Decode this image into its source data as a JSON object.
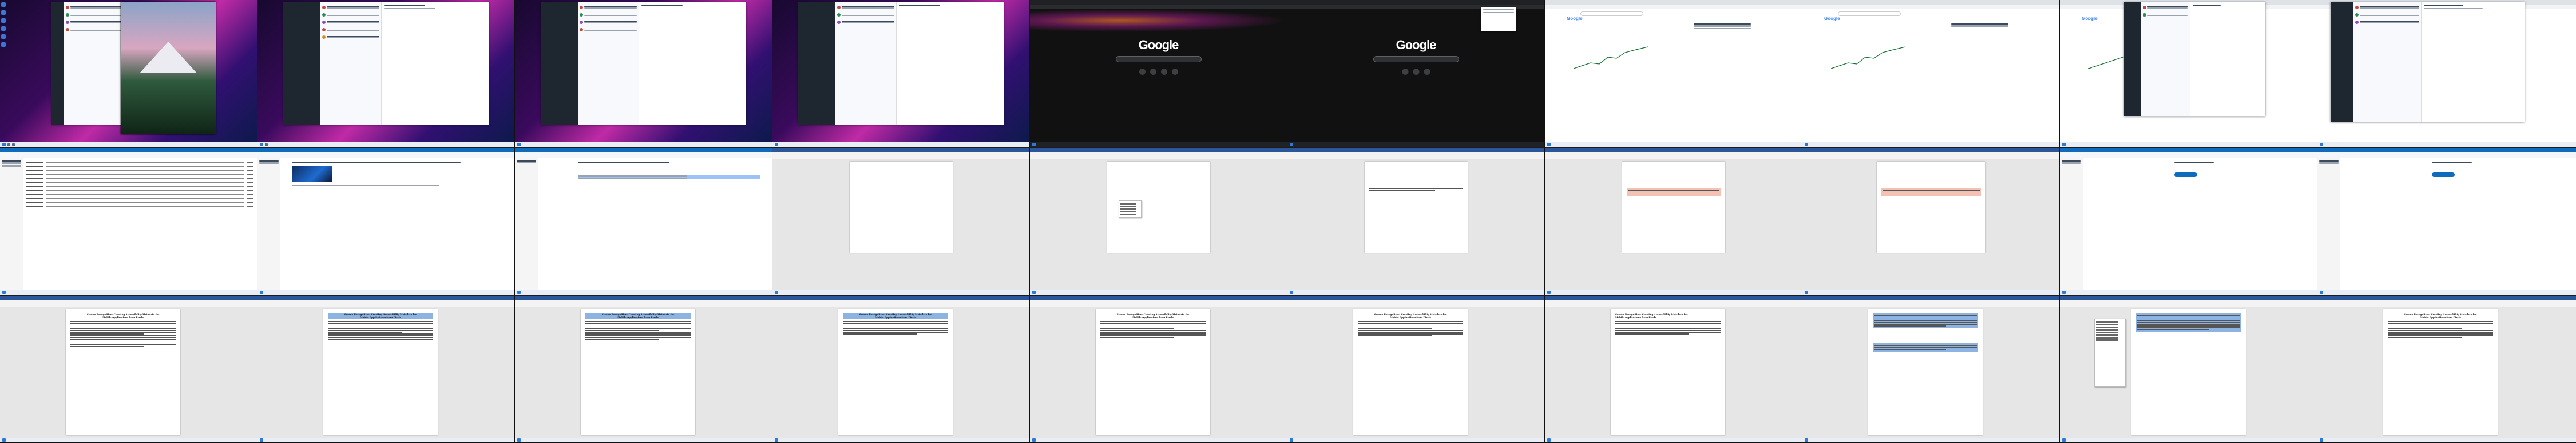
{
  "screen": {
    "columns": 10,
    "rows": 3
  },
  "google": {
    "logo": "Google"
  },
  "stock": {
    "logo": "Google"
  },
  "document": {
    "title_line1": "Screen Recognition: Creating Accessibility Metadata for",
    "title_line2": "Mobile Applications from Pixels"
  },
  "colors": {
    "accent": "#0f6cbd",
    "word_blue": "#2b579a",
    "selection": "#8db3e2"
  }
}
